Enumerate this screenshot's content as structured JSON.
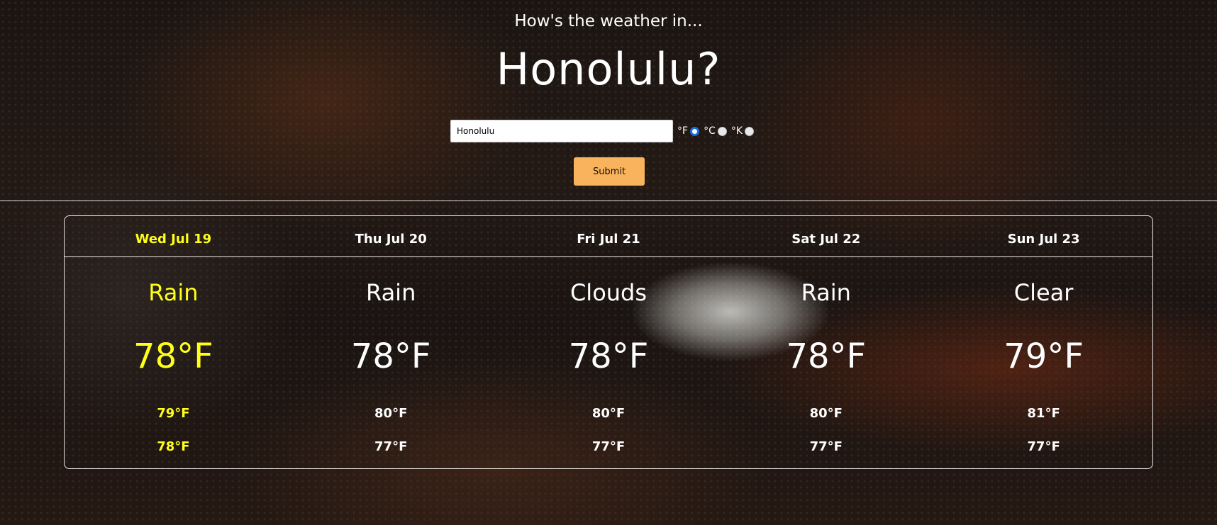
{
  "header": {
    "subtitle": "How's the weather in...",
    "city_title": "Honolulu?"
  },
  "search": {
    "value": "Honolulu",
    "submit_label": "Submit",
    "units": [
      {
        "label": "°F",
        "selected": true
      },
      {
        "label": "°C",
        "selected": false
      },
      {
        "label": "°K",
        "selected": false
      }
    ]
  },
  "colors": {
    "today_accent": "#ffff1a",
    "submit_button": "#f9b35c",
    "radio_selected": "#1a6fe0"
  },
  "forecast": {
    "days": [
      {
        "date": "Wed Jul 19",
        "condition": "Rain",
        "temp": "78°F",
        "high": "79°F",
        "low": "78°F",
        "highlighted": true
      },
      {
        "date": "Thu Jul 20",
        "condition": "Rain",
        "temp": "78°F",
        "high": "80°F",
        "low": "77°F",
        "highlighted": false
      },
      {
        "date": "Fri Jul 21",
        "condition": "Clouds",
        "temp": "78°F",
        "high": "80°F",
        "low": "77°F",
        "highlighted": false
      },
      {
        "date": "Sat Jul 22",
        "condition": "Rain",
        "temp": "78°F",
        "high": "80°F",
        "low": "77°F",
        "highlighted": false
      },
      {
        "date": "Sun Jul 23",
        "condition": "Clear",
        "temp": "79°F",
        "high": "81°F",
        "low": "77°F",
        "highlighted": false
      }
    ]
  }
}
